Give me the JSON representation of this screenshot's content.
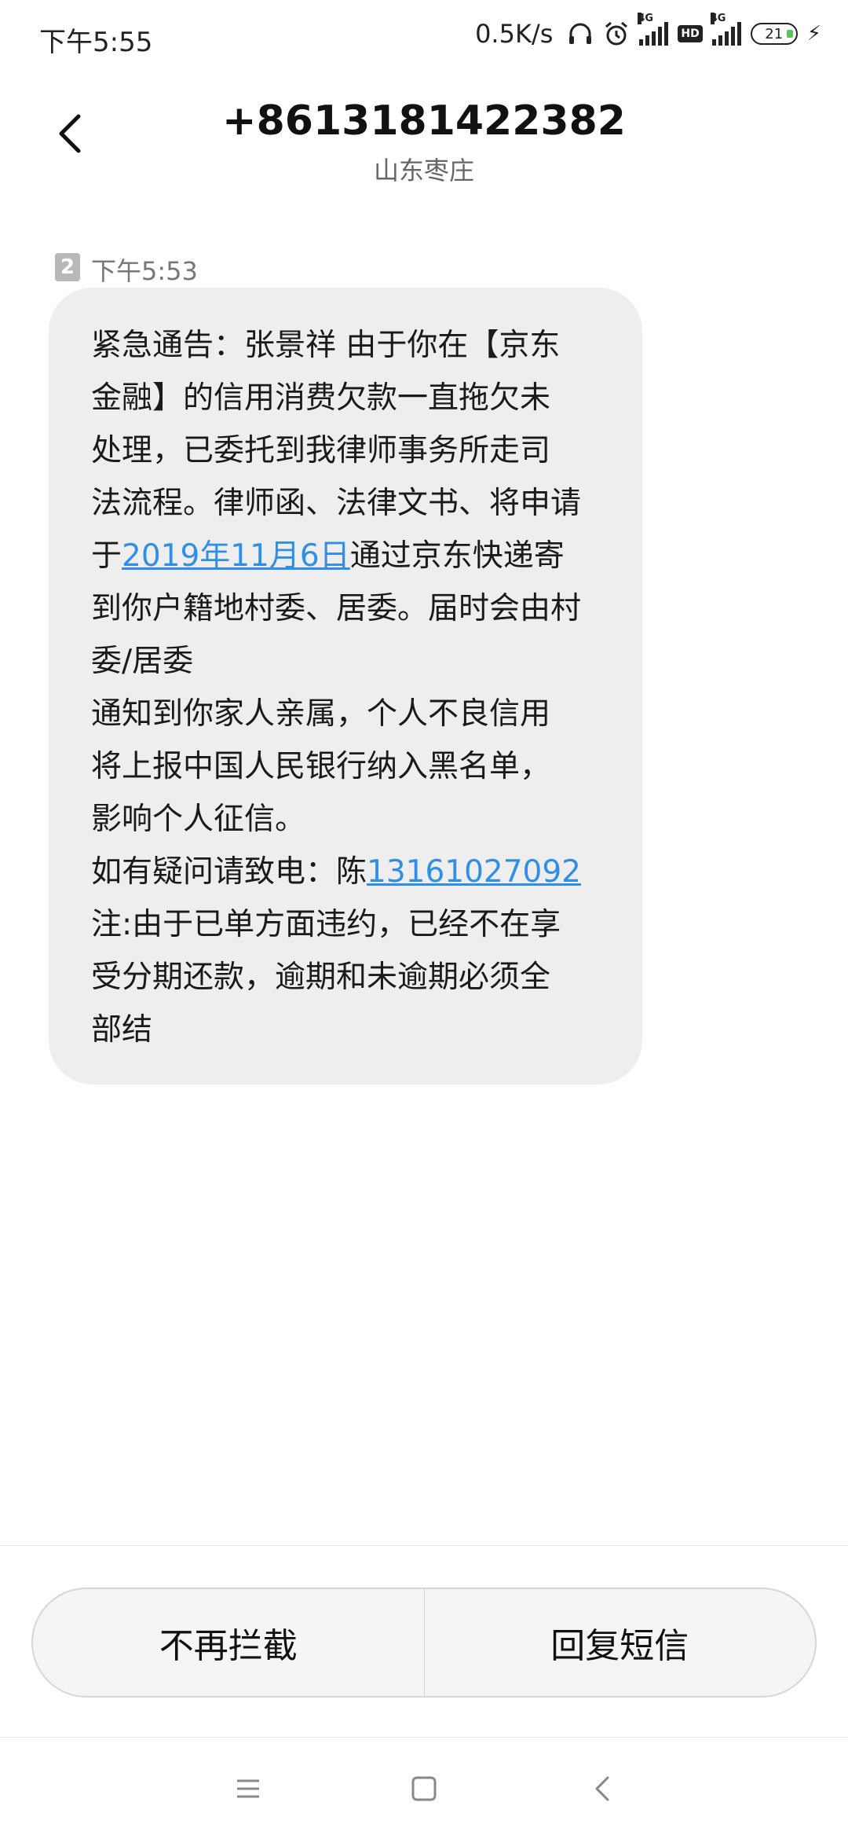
{
  "status_bar": {
    "time": "下午5:55",
    "net_speed": "0.5K/s",
    "sim1_tag": "4G",
    "hd": "HD",
    "sim2_tag": "4G",
    "battery": "21",
    "battery_color": "#5cc35a"
  },
  "header": {
    "title": "+8613181422382",
    "subtitle": "山东枣庄"
  },
  "message": {
    "sim_slot": "2",
    "time": "下午5:53",
    "link_color": "#2f8fe8",
    "lines": [
      "紧急通告：张景祥 由于你在【京东",
      "金融】的信用消费欠款一直拖欠未",
      "处理，已委托到我律师事务所走司",
      "法流程。律师函、法律文书、将申请"
    ],
    "line5_prefix": "于",
    "line5_link": "2019年11月6日",
    "line5_suffix": "通过京东快递寄",
    "lines2": [
      "到你户籍地村委、居委。届时会由村",
      "委/居委",
      "通知到你家人亲属，个人不良信用",
      "将上报中国人民银行纳入黑名单，",
      "影响个人征信。"
    ],
    "phone_prefix": "如有疑问请致电：陈",
    "phone_link": "13161027092",
    "lines3": [
      "注:由于已单方面违约，已经不在享",
      "受分期还款，逾期和未逾期必须全",
      "部结"
    ]
  },
  "actions": {
    "unblock": "不再拦截",
    "reply": "回复短信"
  },
  "icons": {
    "back": "chevron-left-icon",
    "headset": "headset-icon",
    "alarm": "alarm-icon",
    "menu": "menu-icon",
    "home": "home-icon",
    "nav_back": "back-icon"
  }
}
